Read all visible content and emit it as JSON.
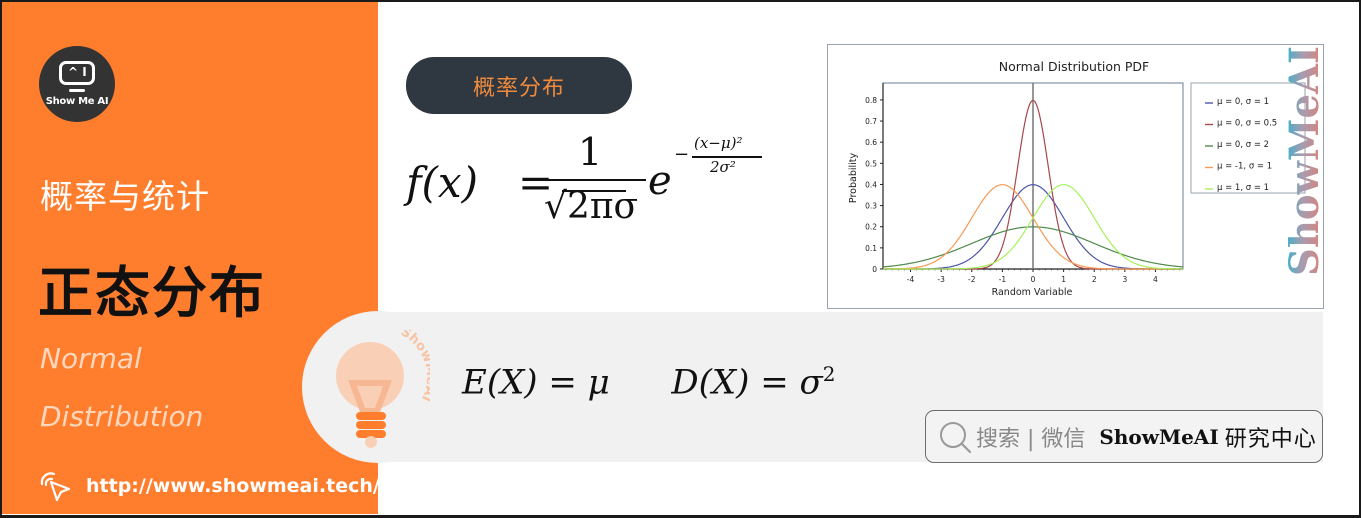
{
  "sidebar": {
    "logo_text": "Show Me AI",
    "logo_screen_glyph": "^ I",
    "subject": "概率与统计",
    "title_cn": "正态分布",
    "title_en_line1": "Normal",
    "title_en_line2": "Distribution",
    "url": "http://www.showmeai.tech/",
    "url_icon": "pointer-cursor-icon"
  },
  "main": {
    "pill_label": "概率分布",
    "pdf_formula": {
      "lhs": "f(x)",
      "equals": "=",
      "numerator": "1",
      "denominator": "√2πσ",
      "base": "e",
      "exponent_sign": "−",
      "exponent_numerator": "(x−μ)²",
      "exponent_denominator": "2σ²"
    },
    "moments_formula": {
      "expectation": "E(X) = μ",
      "variance_prefix": "D(X) = σ",
      "variance_exp": "2"
    },
    "watermark_bulb": "ShowMeAI",
    "side_watermark": "ShowMeAI"
  },
  "search_badge": {
    "icon": "search-icon",
    "label": "搜索 | 微信",
    "brand": "ShowMeAI",
    "suffix": "研究中心"
  },
  "colors": {
    "accent_orange": "#ff7e2e",
    "pill_bg": "#2f3741",
    "pill_text": "#f08a3c",
    "band_bg": "#f1f1f1"
  },
  "chart_data": {
    "type": "line",
    "title": "Normal Distribution PDF",
    "xlabel": "Random Variable",
    "ylabel": "Probability",
    "xlim": [
      -4.9,
      4.9
    ],
    "ylim": [
      0,
      0.88
    ],
    "xticks": [
      -4,
      -3,
      -2,
      -1,
      0,
      1,
      2,
      3,
      4
    ],
    "yticks": [
      0,
      0.1,
      0.2,
      0.3,
      0.4,
      0.5,
      0.6,
      0.7,
      0.8
    ],
    "ytick_labels": [
      "0",
      "0.1",
      "0.2",
      "0.3",
      "0.4",
      "0.5",
      "0.6",
      "0.7",
      "0.8"
    ],
    "legend_position": "right",
    "vertical_line_at": 0,
    "series": [
      {
        "name": "μ = 0, σ = 1",
        "mu": 0,
        "sigma": 1,
        "color": "#4b57a8",
        "peak": 0.399
      },
      {
        "name": "μ = 0, σ = 0.5",
        "mu": 0,
        "sigma": 0.5,
        "color": "#a8474a",
        "peak": 0.798
      },
      {
        "name": "μ = 0, σ = 2",
        "mu": 0,
        "sigma": 2,
        "color": "#4f8a4c",
        "peak": 0.199
      },
      {
        "name": "μ = -1, σ = 1",
        "mu": -1,
        "sigma": 1,
        "color": "#f79a55",
        "peak": 0.399
      },
      {
        "name": "μ = 1, σ = 1",
        "mu": 1,
        "sigma": 1,
        "color": "#a6f05a",
        "peak": 0.399
      }
    ]
  }
}
